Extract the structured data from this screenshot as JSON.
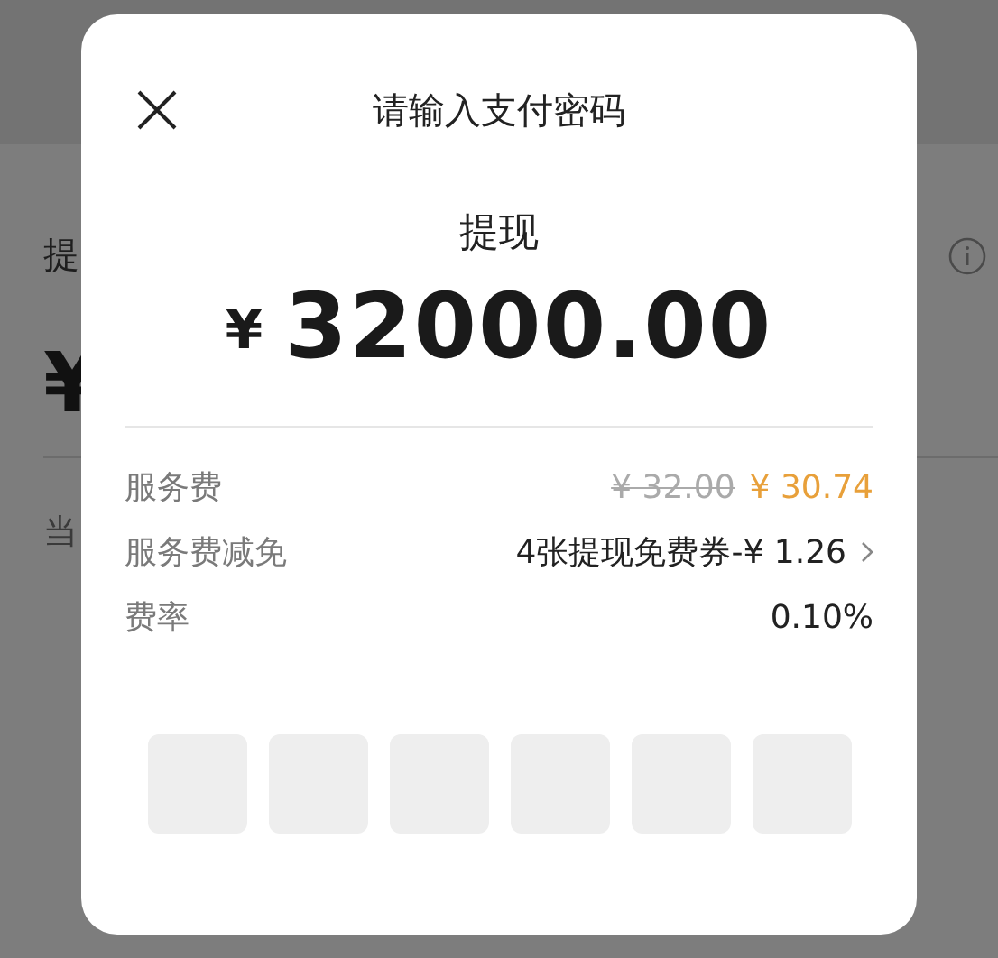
{
  "background": {
    "heading": "提",
    "amount": "¥",
    "note": "当"
  },
  "dialog": {
    "title": "请输入支付密码",
    "subtitle": "提现",
    "currency": "¥",
    "amount": "32000.00",
    "rows": [
      {
        "kind": "price",
        "label": "服务费",
        "original": "¥ 32.00",
        "value": "¥ 30.74"
      },
      {
        "kind": "link",
        "label": "服务费减免",
        "value": "4张提现免费券-¥ 1.26"
      },
      {
        "kind": "plain",
        "label": "费率",
        "value": "0.10%"
      }
    ],
    "pin_boxes": [
      {
        "filled": false
      },
      {
        "filled": false
      },
      {
        "filled": false
      },
      {
        "filled": false
      },
      {
        "filled": false
      },
      {
        "filled": false
      }
    ]
  }
}
